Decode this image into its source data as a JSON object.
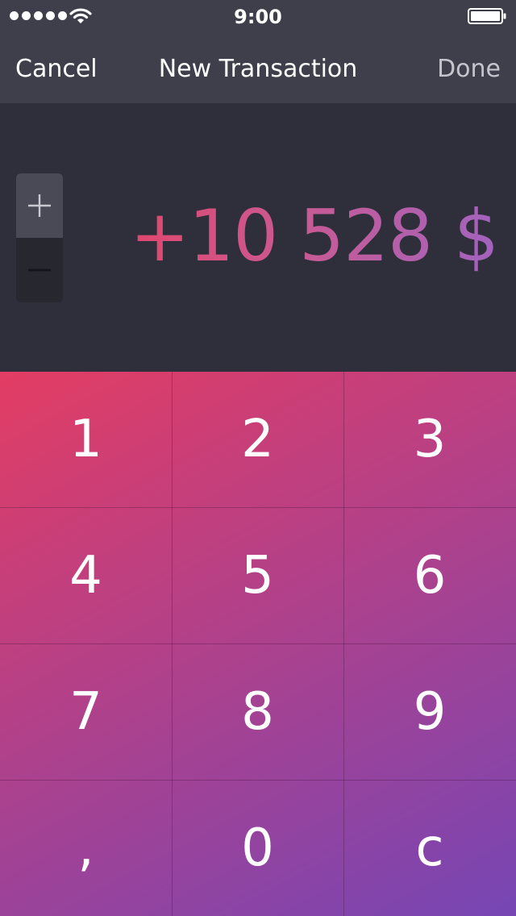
{
  "status_bar": {
    "time": "9:00",
    "signal_icon": "signal-dots-icon",
    "wifi_icon": "wifi-icon",
    "battery_icon": "battery-icon"
  },
  "nav": {
    "cancel_label": "Cancel",
    "title": "New Transaction",
    "done_label": "Done"
  },
  "display": {
    "amount": "+10 528 $",
    "sign_plus": "+",
    "sign_minus": "−",
    "active_sign": "plus"
  },
  "keypad": {
    "keys": [
      "1",
      "2",
      "3",
      "4",
      "5",
      "6",
      "7",
      "8",
      "9",
      ",",
      "0",
      "c"
    ]
  },
  "colors": {
    "chrome": "#3e3f4a",
    "background": "#2e2f3a",
    "gradient_start": "#e33d63",
    "gradient_end": "#7646b4",
    "amount_start": "#e0476d",
    "amount_end": "#a263be"
  }
}
